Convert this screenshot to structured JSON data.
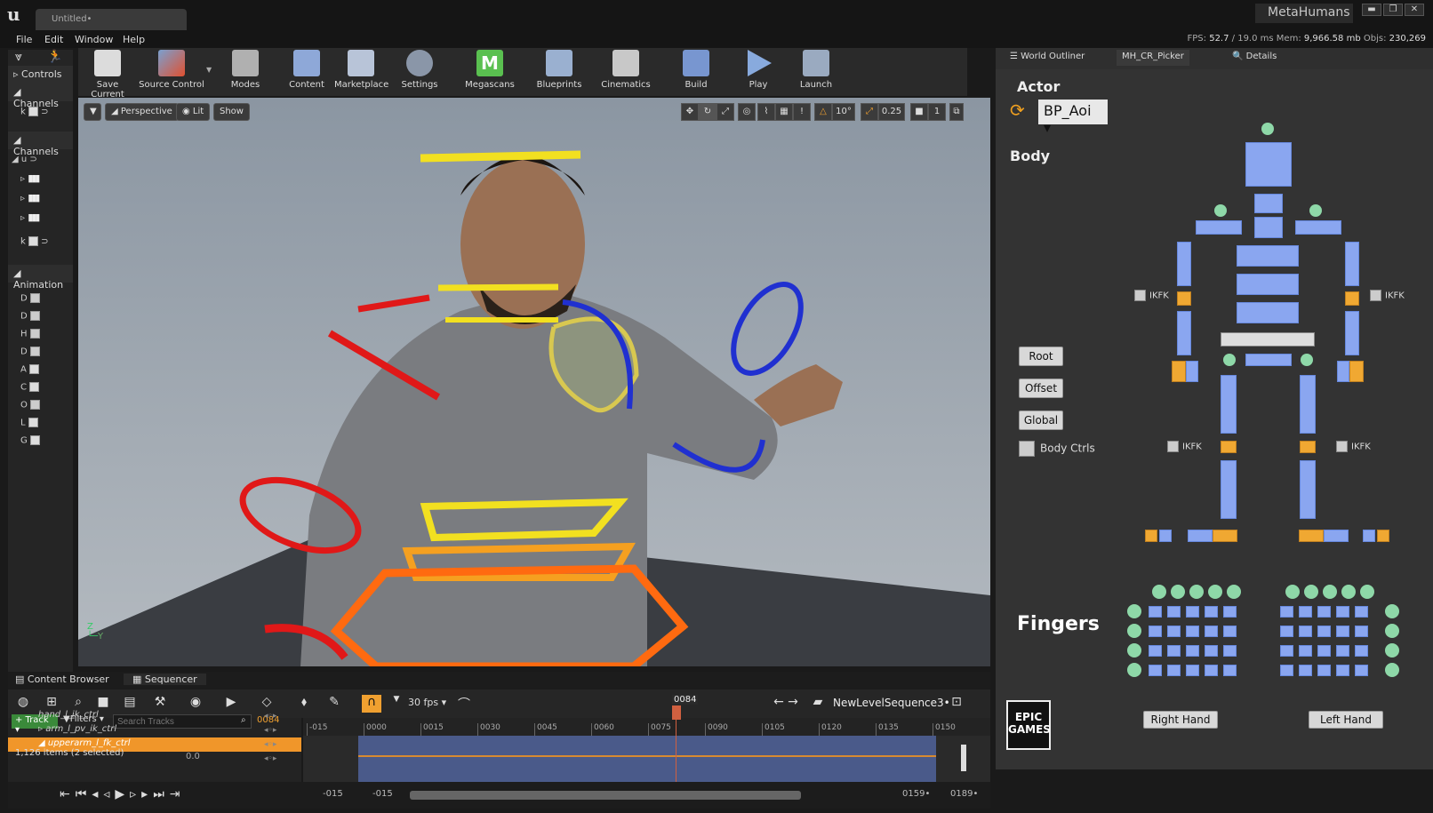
{
  "window": {
    "doc_tab": "Untitled•",
    "project_name": "MetaHumans",
    "minimize": "▬",
    "maximize": "❐",
    "close": "✕"
  },
  "menu": [
    "File",
    "Edit",
    "Window",
    "Help"
  ],
  "stats": {
    "fps_label": "FPS:",
    "fps": "52.7",
    "ms": "/ 19.0 ms",
    "mem_label": "Mem:",
    "mem": "9,966.58 mb",
    "objs_label": "Objs:",
    "objs": "230,269"
  },
  "left_panel": {
    "controls": "Controls",
    "channels_1": "Channels",
    "channels_2": "Channels",
    "animation": "Animation",
    "anim_rows": [
      "D",
      "D",
      "H",
      "D",
      "A",
      "C",
      "O",
      "L",
      "G"
    ]
  },
  "toolbar": {
    "buttons": [
      "Save Current",
      "Source Control",
      "Modes",
      "Content",
      "Marketplace",
      "Settings",
      "Megascans",
      "Blueprints",
      "Cinematics",
      "Build",
      "Play",
      "Launch"
    ]
  },
  "viewport": {
    "perspective": "Perspective",
    "lit": "Lit",
    "show": "Show",
    "rot_snap": "10°",
    "scale_snap": "0.25",
    "cam_speed": "1"
  },
  "right_panel": {
    "tabs": [
      "World Outliner",
      "MH_CR_Picker",
      "Details"
    ],
    "actor_label": "Actor",
    "actor_value": "BP_Aoi",
    "body_label": "Body",
    "ikfk": "IKFK",
    "root": "Root",
    "offset": "Offset",
    "global": "Global",
    "body_ctrls": "Body Ctrls",
    "fingers_label": "Fingers",
    "right_hand": "Right Hand",
    "left_hand": "Left Hand",
    "epic_logo": "EPIC GAMES"
  },
  "sequencer": {
    "tab_content_browser": "Content Browser",
    "tab_sequencer": "Sequencer",
    "fps": "30 fps",
    "sequence_name": "NewLevelSequence3•",
    "track_button": "+ Track",
    "filters_button": "Filters",
    "search_placeholder": "Search Tracks",
    "current_frame": "0084",
    "playhead_label": "0084",
    "tracks": [
      "hand_l_ik_ctrl",
      "arm_l_pv_ik_ctrl",
      "upperarm_l_fk_ctrl"
    ],
    "items_count": "1,126 items (2 selected)",
    "item_value": "0.0",
    "ruler": [
      "-015",
      "0000",
      "0015",
      "0030",
      "0045",
      "0060",
      "0075",
      "0090",
      "0105",
      "0120",
      "0135",
      "0150"
    ],
    "range_start_a": "-015",
    "range_start_b": "-015",
    "range_end_a": "0159•",
    "range_end_b": "0189•"
  }
}
